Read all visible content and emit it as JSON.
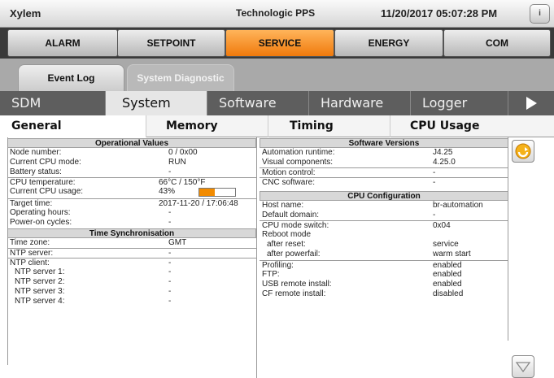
{
  "header": {
    "app_name": "Xylem",
    "project": "Technologic PPS",
    "datetime": "11/20/2017 05:07:28 PM",
    "info_label": "i"
  },
  "main_nav": {
    "tabs": [
      "ALARM",
      "SETPOINT",
      "SERVICE",
      "ENERGY",
      "COM"
    ],
    "active": "SERVICE"
  },
  "sub_tabs": [
    "Event Log",
    "System Diagnostic"
  ],
  "section_tabs": [
    "SDM",
    "System",
    "Software",
    "Hardware",
    "Logger"
  ],
  "detail_tabs": [
    "General",
    "Memory",
    "Timing",
    "CPU Usage"
  ],
  "operational": {
    "title": "Operational Values",
    "rows": [
      {
        "label": "Node number:",
        "value": "0 / 0x00"
      },
      {
        "label": "Current CPU mode:",
        "value": "RUN"
      },
      {
        "label": "Battery status:",
        "value": "-"
      },
      {
        "label": "CPU temperature:",
        "value": "66°C / 150°F"
      },
      {
        "label": "Current CPU usage:",
        "value": "43%"
      },
      {
        "label": "Target time:",
        "value": "2017-11-20 / 17:06:48"
      },
      {
        "label": "Operating hours:",
        "value": "-"
      },
      {
        "label": "Power-on cycles:",
        "value": "-"
      }
    ],
    "cpu_usage_fraction": 0.43,
    "bar_color": "#f28b00"
  },
  "time_sync": {
    "title": "Time Synchronisation",
    "rows": [
      {
        "label": "Time zone:",
        "value": "GMT"
      },
      {
        "label": "NTP server:",
        "value": "-"
      },
      {
        "label": "NTP client:",
        "value": "-"
      },
      {
        "label": "NTP server 1:",
        "value": "-"
      },
      {
        "label": "NTP server 2:",
        "value": "-"
      },
      {
        "label": "NTP server 3:",
        "value": "-"
      },
      {
        "label": "NTP server 4:",
        "value": "-"
      }
    ]
  },
  "software_versions": {
    "title": "Software Versions",
    "rows": [
      {
        "label": "Automation runtime:",
        "value": "J4.25"
      },
      {
        "label": "Visual components:",
        "value": "4.25.0"
      },
      {
        "label": "Motion control:",
        "value": "-"
      },
      {
        "label": "CNC software:",
        "value": "-"
      }
    ]
  },
  "cpu_config": {
    "title": "CPU Configuration",
    "rows": [
      {
        "label": "Host name:",
        "value": "br-automation"
      },
      {
        "label": "Default domain:",
        "value": "-"
      },
      {
        "label": "CPU mode switch:",
        "value": "0x04"
      },
      {
        "label": "Reboot mode",
        "value": ""
      },
      {
        "label": "after reset:",
        "value": "service"
      },
      {
        "label": "after powerfail:",
        "value": "warm start"
      },
      {
        "label": "Profiling:",
        "value": "enabled"
      },
      {
        "label": "FTP:",
        "value": "enabled"
      },
      {
        "label": "USB remote install:",
        "value": "enabled"
      },
      {
        "label": "CF remote install:",
        "value": "disabled"
      }
    ]
  },
  "icons": {
    "refresh": "refresh-icon",
    "scroll_down": "scroll-down-icon",
    "next": "next-arrow-icon"
  },
  "colors": {
    "accent": "#f07a0c",
    "nav_dark": "#3a3a3a",
    "section_bar": "#5e5e5e"
  }
}
